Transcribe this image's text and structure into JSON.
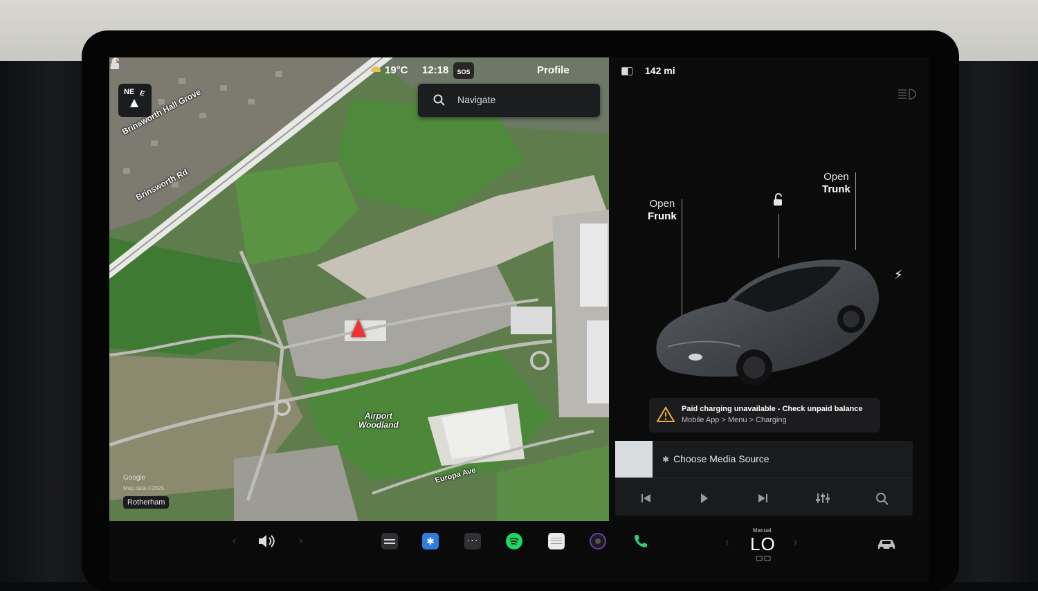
{
  "status_bar": {
    "temperature": "19°C",
    "time": "12:18",
    "sos": "SOS",
    "profile": "Profile"
  },
  "map": {
    "compass_heading": "NE",
    "compass_secondary": "E",
    "search_placeholder": "Navigate",
    "labels": {
      "grove": "Brinsworth Hall Grove",
      "road": "Brinsworth Rd",
      "airport_line1": "Airport",
      "airport_line2": "Woodland",
      "europa": "Europa Ave"
    },
    "attribution": "Google",
    "map_data": "Map data ©2025",
    "city": "Rotherham"
  },
  "vehicle": {
    "range": "142 mi",
    "frunk": {
      "line1": "Open",
      "line2": "Frunk"
    },
    "trunk": {
      "line1": "Open",
      "line2": "Trunk"
    },
    "alert": {
      "title": "Paid charging unavailable - Check unpaid balance",
      "subtitle": "Mobile App > Menu > Charging"
    }
  },
  "media": {
    "source_label": "Choose Media Source"
  },
  "dock": {
    "climate_mode": "Manual",
    "climate_value": "LO"
  },
  "colors": {
    "marker": "#e33333",
    "warning": "#f2b02c",
    "spotify": "#1ed760",
    "phone": "#2ecc71",
    "bluetooth": "#2f7ce0"
  }
}
